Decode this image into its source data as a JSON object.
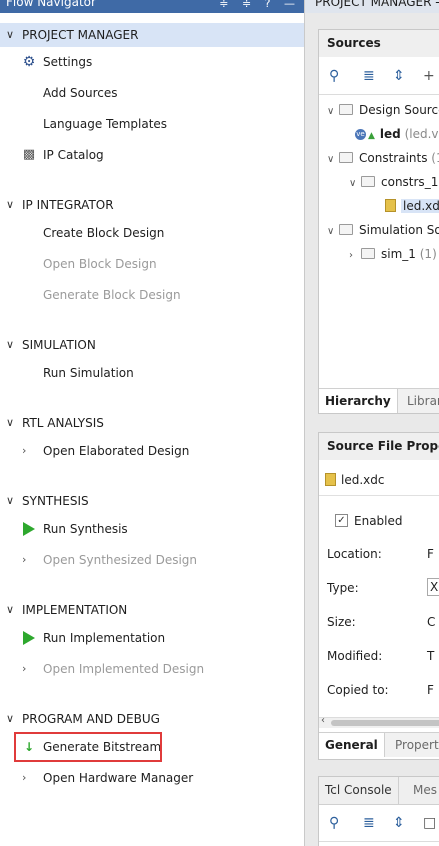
{
  "flow_navigator": {
    "title": "Flow Navigator",
    "header_icons": "≑ ≑ ? —",
    "sections": [
      {
        "label": "PROJECT MANAGER",
        "selected": true,
        "items": [
          {
            "label": "Settings",
            "icon": "gear-icon"
          },
          {
            "label": "Add Sources"
          },
          {
            "label": "Language Templates"
          },
          {
            "label": "IP Catalog",
            "icon": "ip-catalog-icon"
          }
        ]
      },
      {
        "label": "IP INTEGRATOR",
        "items": [
          {
            "label": "Create Block Design"
          },
          {
            "label": "Open Block Design",
            "disabled": true
          },
          {
            "label": "Generate Block Design",
            "disabled": true
          }
        ]
      },
      {
        "label": "SIMULATION",
        "items": [
          {
            "label": "Run Simulation"
          }
        ]
      },
      {
        "label": "RTL ANALYSIS",
        "items": [
          {
            "label": "Open Elaborated Design",
            "chevron": true
          }
        ]
      },
      {
        "label": "SYNTHESIS",
        "items": [
          {
            "label": "Run Synthesis",
            "icon": "run-play-icon"
          },
          {
            "label": "Open Synthesized Design",
            "chevron": true,
            "disabled": true
          }
        ]
      },
      {
        "label": "IMPLEMENTATION",
        "items": [
          {
            "label": "Run Implementation",
            "icon": "run-play-icon"
          },
          {
            "label": "Open Implemented Design",
            "chevron": true,
            "disabled": true
          }
        ]
      },
      {
        "label": "PROGRAM AND DEBUG",
        "items": [
          {
            "label": "Generate Bitstream",
            "icon": "bitstream-icon",
            "highlighted": true
          },
          {
            "label": "Open Hardware Manager",
            "chevron": true
          }
        ]
      }
    ]
  },
  "project_manager": {
    "header": "PROJECT MANAGER -",
    "sources": {
      "title": "Sources",
      "tree": [
        {
          "label": "Design Source",
          "type": "folder"
        },
        {
          "label": "led",
          "suffix": "(led.v",
          "type": "verilog"
        },
        {
          "label": "Constraints",
          "suffix": "(1",
          "type": "folder"
        },
        {
          "label": "constrs_1",
          "type": "folder"
        },
        {
          "label": "led.xd",
          "type": "xdc"
        },
        {
          "label": "Simulation So",
          "type": "folder"
        },
        {
          "label": "sim_1",
          "suffix": "(1)",
          "type": "folder"
        }
      ],
      "tabs": [
        "Hierarchy",
        "Librar"
      ]
    },
    "properties": {
      "title": "Source File Propert",
      "file": "led.xdc",
      "enabled_label": "Enabled",
      "fields": [
        {
          "label": "Location:",
          "value": "F"
        },
        {
          "label": "Type:",
          "value": "X"
        },
        {
          "label": "Size:",
          "value": "C"
        },
        {
          "label": "Modified:",
          "value": "T"
        },
        {
          "label": "Copied to:",
          "value": "F"
        }
      ],
      "tabs": [
        "General",
        "Properti"
      ]
    },
    "console": {
      "tabs": [
        "Tcl Console",
        "Mes"
      ]
    }
  }
}
